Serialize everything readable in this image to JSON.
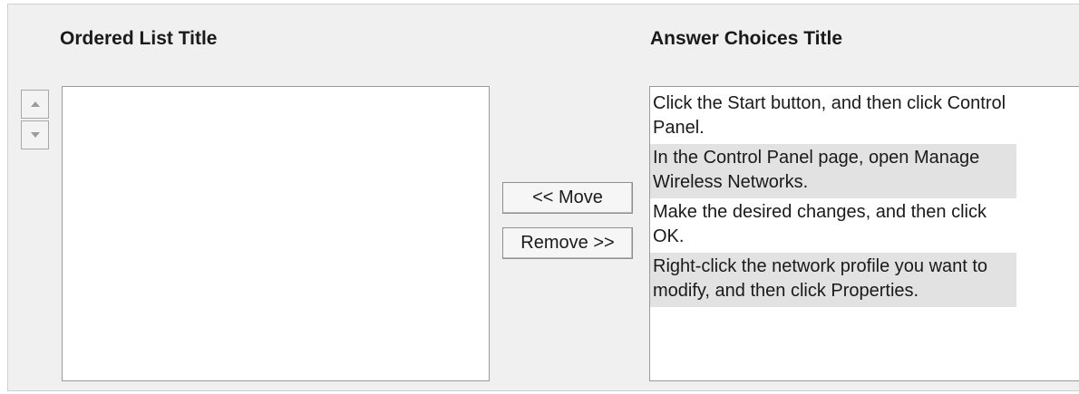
{
  "ordered_list": {
    "title": "Ordered List Title",
    "items": []
  },
  "answer_choices": {
    "title": "Answer Choices Title",
    "items": [
      "Click the Start button, and then click Control Panel.",
      "In the Control Panel page, open Manage Wireless Networks.",
      "Make the desired changes, and then click OK.",
      "Right-click the network profile you want to modify, and then click Properties."
    ]
  },
  "buttons": {
    "move_label": "<< Move",
    "remove_label": "Remove >>"
  },
  "icons": {
    "move_up": "triangle-up-icon",
    "move_down": "triangle-down-icon"
  }
}
